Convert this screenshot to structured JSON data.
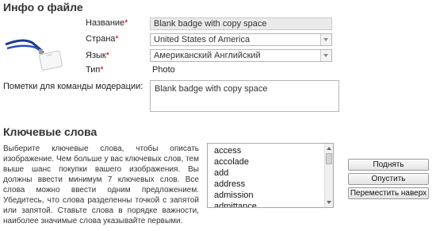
{
  "file_info": {
    "section_title": "Инфо о файле",
    "name": {
      "label": "Название",
      "required_mark": "*",
      "value": "Blank badge with copy space"
    },
    "country": {
      "label": "Страна",
      "required_mark": "*",
      "value": "United States of America"
    },
    "language": {
      "label": "Язык",
      "required_mark": "*",
      "value": "Американский Английский"
    },
    "type": {
      "label": "Тип",
      "required_mark": "*",
      "value": "Photo"
    },
    "moderation_notes": {
      "label": "Пометки для команды модерации:",
      "value": "Blank badge with copy space"
    }
  },
  "keywords": {
    "section_title": "Ключевые слова",
    "description": "Выберите ключевые слова, чтобы описать изображение. Чем больше у вас ключевых слов, тем выше шанс покупки вашего изображения. Вы должны ввести минимум 7 ключевых слов. Все слова можно ввести одним предложением. Убедитесь, что слова разделенны точкой с запятой или запятой. Ставьте слова в порядке важности, наиболее значимые слова указывайте первыми.",
    "list": [
      "access",
      "accolade",
      "add",
      "address",
      "admission",
      "admittance"
    ],
    "buttons": {
      "move_up": "Поднять",
      "move_down": "Опустить",
      "move_top": "Переместить наверх"
    }
  },
  "thumbnail": {
    "icon": "badge-lanyard-photo"
  }
}
